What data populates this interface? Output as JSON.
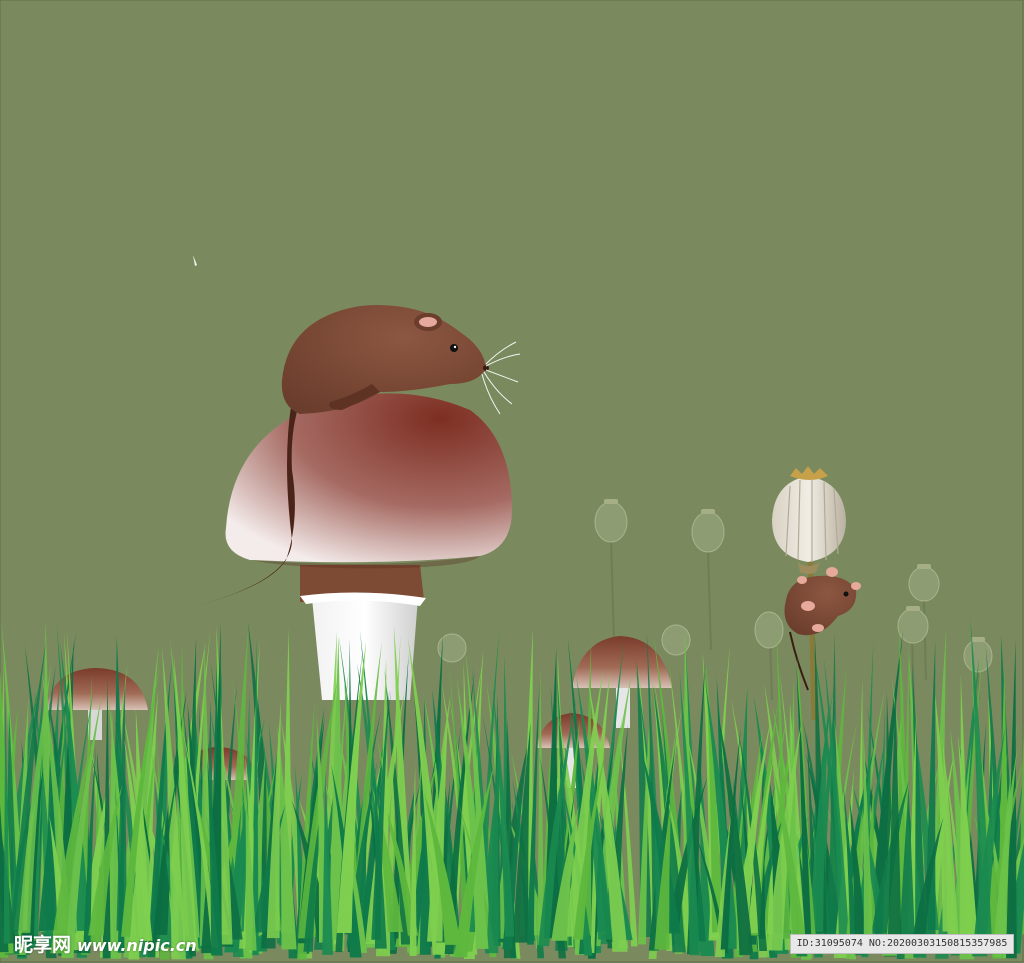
{
  "scene": {
    "background_color": "#7a8a5e",
    "grass_dark": "#0f7a4a",
    "grass_light": "#6cc24a",
    "mushroom_cap_color": "#8a3b2e",
    "mouse_color": "#7d4a36",
    "poppy_pod_color": "#8e9c73"
  },
  "watermark": {
    "brand_text": "昵享网",
    "site_text": "www.nipic.cn",
    "id_text": "ID:31095074 NO:20200303150815357985"
  }
}
